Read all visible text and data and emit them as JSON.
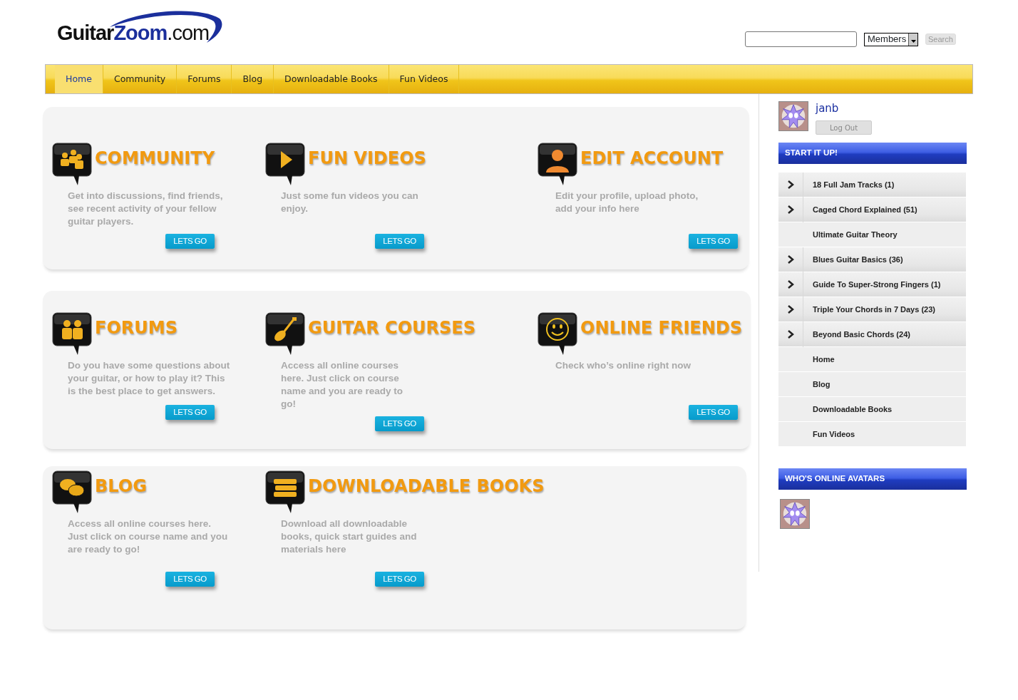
{
  "logo": {
    "parts": [
      {
        "text": "Guitar",
        "kind": "dark"
      },
      {
        "text": "Zoom",
        "kind": "accent"
      },
      {
        "text": ".com",
        "kind": "light"
      }
    ]
  },
  "search": {
    "select_value": "Members",
    "button": "Search"
  },
  "nav": [
    {
      "label": "Home",
      "selected": true
    },
    {
      "label": "Community",
      "selected": false
    },
    {
      "label": "Forums",
      "selected": false
    },
    {
      "label": "Blog",
      "selected": false
    },
    {
      "label": "Downloadable Books",
      "selected": false
    },
    {
      "label": "Fun Videos",
      "selected": false
    }
  ],
  "panels": [
    {
      "tiles": [
        {
          "title": "COMMUNITY",
          "description": "Get into discussions, find friends, see recent activity of your fellow guitar players.",
          "button": "LETS GO"
        },
        {
          "title": "FUN VIDEOS",
          "description": "Just some fun videos you can enjoy.",
          "button": "LETS GO"
        },
        {
          "title": "EDIT ACCOUNT",
          "description": "Edit your profile, upload photo, add your info here",
          "button": "LETS GO"
        }
      ]
    },
    {
      "tiles": [
        {
          "title": "FORUMS",
          "description": "Do you have some questions about your guitar, or how to play it? This is the best place to get answers.",
          "button": "LETS GO"
        },
        {
          "title": "GUITAR COURSES",
          "description": "Access all online courses here. Just click on course name and you are ready to go!",
          "button": "LETS GO"
        },
        {
          "title": "ONLINE FRIENDS",
          "description": "Check who’s online right now",
          "button": "LETS GO"
        }
      ]
    },
    {
      "tiles": [
        {
          "title": "BLOG",
          "description": "Access all online courses here. Just click on course name and you are ready to go!",
          "button": "LETS GO"
        },
        {
          "title": "DOWNLOADABLE BOOKS",
          "description": "Download all downloadable books, quick start guides and materials here",
          "button": "LETS GO"
        }
      ]
    }
  ],
  "user": {
    "name": "janb",
    "logout": "Log Out"
  },
  "start_menu": {
    "title": "START IT UP!",
    "items": [
      {
        "label": "18 Full Jam Tracks (1)",
        "expandable": true
      },
      {
        "label": "Caged Chord Explained (51)",
        "expandable": true
      },
      {
        "label": "Ultimate Guitar Theory",
        "expandable": false
      },
      {
        "label": "Blues Guitar Basics (36)",
        "expandable": true
      },
      {
        "label": "Guide To Super-Strong Fingers (1)",
        "expandable": true
      },
      {
        "label": "Triple Your Chords in 7 Days (23)",
        "expandable": true
      },
      {
        "label": "Beyond Basic Chords (24)",
        "expandable": true
      },
      {
        "label": "Home",
        "expandable": false
      },
      {
        "label": "Blog",
        "expandable": false
      },
      {
        "label": "Downloadable Books",
        "expandable": false
      },
      {
        "label": "Fun Videos",
        "expandable": false
      }
    ]
  },
  "online": {
    "title": "WHO'S ONLINE AVATARS"
  }
}
